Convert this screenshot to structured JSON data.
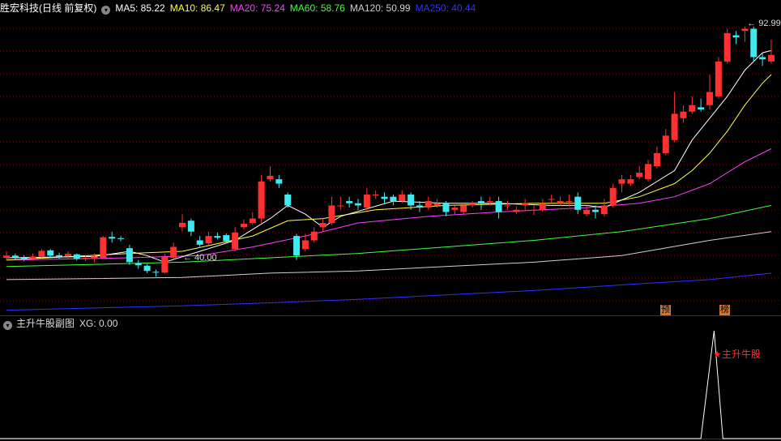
{
  "header": {
    "stock": "胜宏科技(日线 前复权)",
    "ma": [
      {
        "label": "MA5: 85.22",
        "color": "#ffffff"
      },
      {
        "label": "MA10: 86.47",
        "color": "#ffff40"
      },
      {
        "label": "MA20: 75.24",
        "color": "#ff40ff"
      },
      {
        "label": "MA60: 58.76",
        "color": "#40ff40"
      },
      {
        "label": "MA120: 50.99",
        "color": "#d0d0d0"
      },
      {
        "label": "MA250: 40.44",
        "color": "#3030ff"
      }
    ]
  },
  "annotations": {
    "high_label": "92.99",
    "low_label": "40.00",
    "badge1": "预",
    "badge2": "榜"
  },
  "sub": {
    "title": "主升牛股副图",
    "xg": "XG: 0.00",
    "signal_label": "主升牛股"
  },
  "colors": {
    "up": "#ff3030",
    "down": "#40e8f0",
    "grid": "#8b0000",
    "ma5": "#ffffff",
    "ma10": "#ffff40",
    "ma20": "#ff40ff",
    "ma60": "#40ff40",
    "ma120": "#d0d0d0",
    "ma250": "#3030ff"
  },
  "chart_data": {
    "type": "candlestick",
    "y_range": [
      30,
      98
    ],
    "candles": [
      [
        43.0,
        43.5,
        44.5,
        42.5
      ],
      [
        43.5,
        43.1,
        44.0,
        42.4
      ],
      [
        43.0,
        42.8,
        43.6,
        42.2
      ],
      [
        42.8,
        43.3,
        44.0,
        42.4
      ],
      [
        43.3,
        44.6,
        45.0,
        43.0
      ],
      [
        44.7,
        43.5,
        45.0,
        43.0
      ],
      [
        43.6,
        43.3,
        44.2,
        42.8
      ],
      [
        43.4,
        43.9,
        44.5,
        42.9
      ],
      [
        43.8,
        42.8,
        44.0,
        42.4
      ],
      [
        42.9,
        43.0,
        43.6,
        42.3
      ],
      [
        42.8,
        43.3,
        44.0,
        42.0
      ],
      [
        43.0,
        47.7,
        48.0,
        42.8
      ],
      [
        47.8,
        47.4,
        49.0,
        46.5
      ],
      [
        47.5,
        47.3,
        48.0,
        46.8
      ],
      [
        45.2,
        42.0,
        46.0,
        41.4
      ],
      [
        41.8,
        41.3,
        42.5,
        40.5
      ],
      [
        41.2,
        40.0,
        41.6,
        39.5
      ],
      [
        39.8,
        39.6,
        40.3,
        38.7
      ],
      [
        39.6,
        43.2,
        44.0,
        39.4
      ],
      [
        43.0,
        45.5,
        46.5,
        42.8
      ],
      [
        50.0,
        51.0,
        53.0,
        49.0
      ],
      [
        51.5,
        49.0,
        52.0,
        48.0
      ],
      [
        47.0,
        46.0,
        48.0,
        45.5
      ],
      [
        46.3,
        48.0,
        49.0,
        46.0
      ],
      [
        48.0,
        47.6,
        48.8,
        47.2
      ],
      [
        48.2,
        46.8,
        48.6,
        46.5
      ],
      [
        45.0,
        48.8,
        50.0,
        44.5
      ],
      [
        50.0,
        50.8,
        51.8,
        49.5
      ],
      [
        51.0,
        52.0,
        53.5,
        50.5
      ],
      [
        52.0,
        60.5,
        62.0,
        51.0
      ],
      [
        61.0,
        61.8,
        64.0,
        60.5
      ],
      [
        61.0,
        60.0,
        62.0,
        59.0
      ],
      [
        57.5,
        55.0,
        58.0,
        54.5
      ],
      [
        48.0,
        43.5,
        48.5,
        42.5
      ],
      [
        45.0,
        47.0,
        48.5,
        44.5
      ],
      [
        47.0,
        49.0,
        50.0,
        46.5
      ],
      [
        50.0,
        51.0,
        52.0,
        49.0
      ],
      [
        51.0,
        55.0,
        57.0,
        50.5
      ],
      [
        55.0,
        55.0,
        57.0,
        54.0
      ],
      [
        56.0,
        55.5,
        57.0,
        54.5
      ],
      [
        55.5,
        55.0,
        56.5,
        54.0
      ],
      [
        54.5,
        57.5,
        59.0,
        54.0
      ],
      [
        57.5,
        57.5,
        58.5,
        56.5
      ],
      [
        57.0,
        56.5,
        58.0,
        55.5
      ],
      [
        57.0,
        56.0,
        57.5,
        55.0
      ],
      [
        56.0,
        57.5,
        58.5,
        55.5
      ],
      [
        57.5,
        55.0,
        58.0,
        54.0
      ],
      [
        55.0,
        54.5,
        56.0,
        53.5
      ],
      [
        54.5,
        56.0,
        57.0,
        54.0
      ],
      [
        55.0,
        55.5,
        56.5,
        54.5
      ],
      [
        55.5,
        53.5,
        56.0,
        52.5
      ],
      [
        54.0,
        54.5,
        55.0,
        53.0
      ],
      [
        53.5,
        55.0,
        55.5,
        53.0
      ],
      [
        55.0,
        55.5,
        56.0,
        54.5
      ],
      [
        56.0,
        55.5,
        57.0,
        54.0
      ],
      [
        56.0,
        56.0,
        57.0,
        55.0
      ],
      [
        56.0,
        53.5,
        57.0,
        52.0
      ],
      [
        55.0,
        55.0,
        56.0,
        54.0
      ],
      [
        53.5,
        54.0,
        54.8,
        53.0
      ],
      [
        55.0,
        55.5,
        56.5,
        54.0
      ],
      [
        54.0,
        54.0,
        55.0,
        52.8
      ],
      [
        54.0,
        55.5,
        56.5,
        53.5
      ],
      [
        56.5,
        56.5,
        57.5,
        55.5
      ],
      [
        55.5,
        56.0,
        57.0,
        55.0
      ],
      [
        56.0,
        56.0,
        57.5,
        55.0
      ],
      [
        57.0,
        54.0,
        58.0,
        53.0
      ],
      [
        53.0,
        54.0,
        55.0,
        52.5
      ],
      [
        54.0,
        53.5,
        55.0,
        52.0
      ],
      [
        53.0,
        55.0,
        56.5,
        52.5
      ],
      [
        55.0,
        59.0,
        60.0,
        54.5
      ],
      [
        60.0,
        61.0,
        62.0,
        58.0
      ],
      [
        60.0,
        61.0,
        62.0,
        59.5
      ],
      [
        61.5,
        62.5,
        64.0,
        61.0
      ],
      [
        61.0,
        64.5,
        65.5,
        60.5
      ],
      [
        64.0,
        67.0,
        68.5,
        63.5
      ],
      [
        67.0,
        71.0,
        72.5,
        66.5
      ],
      [
        70.0,
        76.0,
        81.0,
        69.5
      ],
      [
        75.0,
        76.5,
        78.0,
        74.0
      ],
      [
        76.5,
        78.0,
        80.0,
        76.0
      ],
      [
        77.5,
        77.0,
        79.5,
        76.5
      ],
      [
        78.0,
        81.0,
        85.0,
        77.0
      ],
      [
        80.0,
        88.0,
        89.0,
        79.5
      ],
      [
        88.0,
        94.5,
        95.5,
        87.5
      ],
      [
        94.0,
        93.5,
        95.0,
        92.0
      ],
      [
        95.0,
        95.5,
        96.0,
        92.5
      ],
      [
        95.5,
        89.0,
        96.0,
        88.0
      ],
      [
        89.0,
        88.5,
        90.0,
        87.0
      ],
      [
        88.0,
        89.5,
        93.0,
        87.5
      ]
    ],
    "ma_series": {
      "ma5": [
        [
          0,
          43.0
        ],
        [
          10,
          43.3
        ],
        [
          14,
          44.5
        ],
        [
          16,
          43.5
        ],
        [
          18,
          42.0
        ],
        [
          22,
          44.5
        ],
        [
          26,
          47.0
        ],
        [
          30,
          52.0
        ],
        [
          32,
          55.0
        ],
        [
          34,
          53.0
        ],
        [
          36,
          50.0
        ],
        [
          38,
          52.5
        ],
        [
          44,
          56.0
        ],
        [
          50,
          55.5
        ],
        [
          56,
          55.5
        ],
        [
          62,
          55.0
        ],
        [
          66,
          55.0
        ],
        [
          68,
          54.5
        ],
        [
          72,
          58.0
        ],
        [
          76,
          63.0
        ],
        [
          78,
          70.0
        ],
        [
          80,
          75.0
        ],
        [
          82,
          80.0
        ],
        [
          84,
          86.0
        ],
        [
          86,
          90.0
        ],
        [
          87,
          90.5
        ]
      ],
      "ma10": [
        [
          0,
          42.5
        ],
        [
          14,
          44.0
        ],
        [
          20,
          44.5
        ],
        [
          28,
          48.0
        ],
        [
          32,
          51.5
        ],
        [
          36,
          52.0
        ],
        [
          42,
          54.0
        ],
        [
          50,
          55.0
        ],
        [
          60,
          55.5
        ],
        [
          68,
          55.5
        ],
        [
          72,
          57.0
        ],
        [
          76,
          60.0
        ],
        [
          78,
          63.0
        ],
        [
          80,
          67.0
        ],
        [
          82,
          72.0
        ],
        [
          84,
          78.0
        ],
        [
          86,
          83.0
        ],
        [
          87,
          85.0
        ]
      ],
      "ma20": [
        [
          0,
          42.5
        ],
        [
          14,
          43.0
        ],
        [
          22,
          43.5
        ],
        [
          28,
          45.5
        ],
        [
          34,
          48.0
        ],
        [
          40,
          51.0
        ],
        [
          48,
          52.5
        ],
        [
          56,
          53.5
        ],
        [
          66,
          54.5
        ],
        [
          72,
          55.5
        ],
        [
          76,
          57.0
        ],
        [
          80,
          60.0
        ],
        [
          84,
          65.0
        ],
        [
          87,
          68.0
        ]
      ],
      "ma60": [
        [
          0,
          41.0
        ],
        [
          20,
          42.0
        ],
        [
          30,
          43.0
        ],
        [
          40,
          44.0
        ],
        [
          50,
          45.5
        ],
        [
          60,
          47.0
        ],
        [
          70,
          49.0
        ],
        [
          80,
          52.0
        ],
        [
          87,
          55.0
        ]
      ],
      "ma120": [
        [
          0,
          38.0
        ],
        [
          20,
          38.5
        ],
        [
          30,
          39.5
        ],
        [
          40,
          40.0
        ],
        [
          50,
          41.0
        ],
        [
          60,
          42.0
        ],
        [
          70,
          43.5
        ],
        [
          80,
          47.0
        ],
        [
          87,
          49.0
        ]
      ],
      "ma250": [
        [
          0,
          31.0
        ],
        [
          20,
          32.0
        ],
        [
          30,
          32.7
        ],
        [
          40,
          33.5
        ],
        [
          50,
          34.5
        ],
        [
          60,
          35.5
        ],
        [
          70,
          36.8
        ],
        [
          80,
          38.0
        ],
        [
          87,
          39.5
        ]
      ]
    },
    "signal": [
      [
        79,
        0
      ],
      [
        80.5,
        1
      ],
      [
        81.5,
        0
      ]
    ]
  }
}
